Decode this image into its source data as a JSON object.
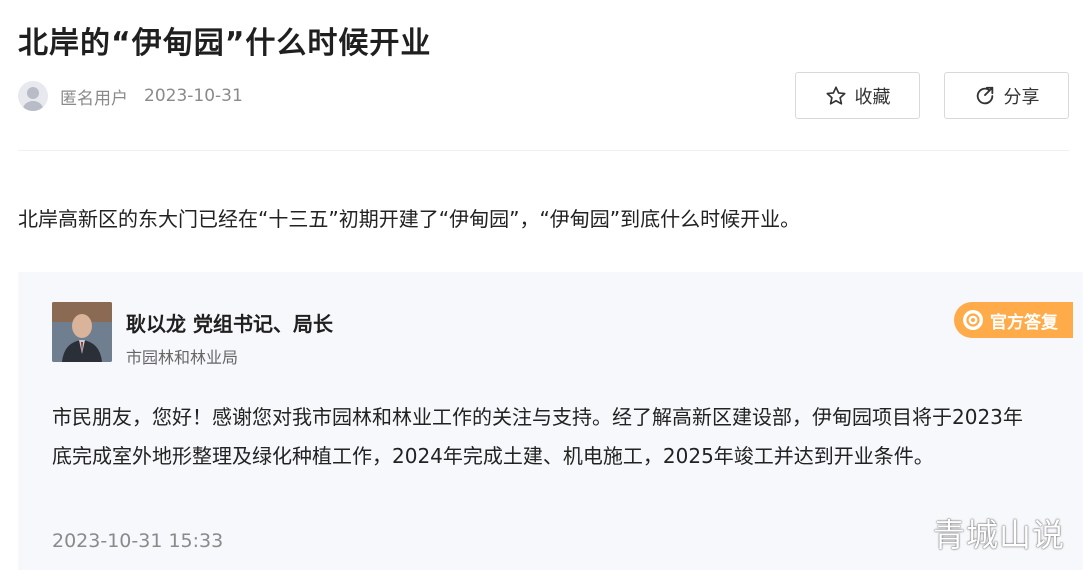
{
  "question": {
    "title": "北岸的“伊甸园”什么时候开业",
    "author": "匿名用户",
    "date": "2023-10-31",
    "body": "北岸高新区的东大门已经在“十三五”初期开建了“伊甸园”，“伊甸园”到底什么时候开业。"
  },
  "actions": {
    "favorite_label": "收藏",
    "share_label": "分享"
  },
  "answer": {
    "name_title": "耿以龙  党组书记、局长",
    "department": "市园林和林业局",
    "badge_label": "官方答复",
    "text": "市民朋友，您好！感谢您对我市园林和林业工作的关注与支持。经了解高新区建设部，伊甸园项目将于2023年底完成室外地形整理及绿化种植工作，2024年完成土建、机电施工，2025年竣工并达到开业条件。",
    "time": "2023-10-31 15:33"
  },
  "watermark": "青城山说",
  "icons": {
    "favorite": "star-icon",
    "share": "share-icon",
    "avatar": "user-avatar-icon",
    "badge": "official-badge-icon"
  },
  "colors": {
    "badge": "#ffab4a",
    "card_bg": "#f7f8fb",
    "muted_text": "#8a8a8a"
  }
}
